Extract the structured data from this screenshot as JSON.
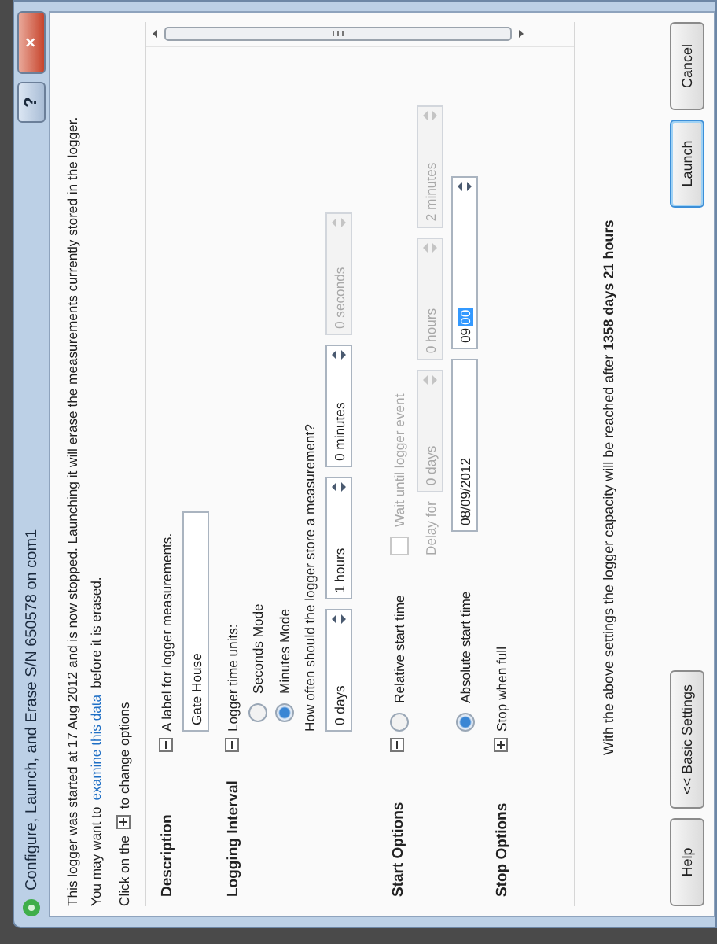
{
  "window": {
    "title": "Configure, Launch, and Erase S/N 650578 on com1",
    "help_button": "?",
    "close_button": "×"
  },
  "notice": "This logger was started at 17 Aug 2012 and is now stopped. Launching it will erase the measurements currently stored in the logger.",
  "examine": {
    "before": "You may want to",
    "link": "examine this data",
    "after": "before it is erased."
  },
  "hint": {
    "before": "Click on the",
    "after": "to change options"
  },
  "sections": [
    {
      "kind": "description",
      "label": "Description",
      "expanded": true,
      "prompt": "A label for logger measurements.",
      "value": "Gate House"
    },
    {
      "kind": "interval",
      "label": "Logging Interval",
      "expanded": true,
      "prompt": "Logger time units:",
      "modes": [
        {
          "label": "Seconds Mode",
          "selected": false
        },
        {
          "label": "Minutes Mode",
          "selected": true
        }
      ],
      "question": "How often should the logger store a measurement?",
      "fields": [
        {
          "value": "0 days",
          "disabled": false
        },
        {
          "value": "1 hours",
          "disabled": false
        },
        {
          "value": "0 minutes",
          "disabled": false
        },
        {
          "value": "0 seconds",
          "disabled": true
        }
      ]
    },
    {
      "kind": "start",
      "label": "Start Options",
      "expanded": true,
      "relative": {
        "label": "Relative start time",
        "selected": false,
        "wait": {
          "label": "Wait until logger event",
          "checked": false,
          "disabled": true
        },
        "delay_label": "Delay for",
        "fields": [
          {
            "value": "0 days",
            "disabled": true
          },
          {
            "value": "0 hours",
            "disabled": true
          },
          {
            "value": "2 minutes",
            "disabled": true
          }
        ]
      },
      "absolute": {
        "label": "Absolute start time",
        "selected": true,
        "date": "08/09/2012",
        "hour": "09",
        "minute": "00"
      }
    },
    {
      "kind": "stop",
      "label": "Stop Options",
      "expanded": false,
      "summary": "Stop when full"
    }
  ],
  "capacity": "With the above settings the logger capacity will be reached after **1358 days 21 hours**",
  "buttons_left": [
    {
      "label": "Help",
      "default": false
    },
    {
      "label": "<< Basic Settings",
      "default": false
    }
  ],
  "buttons_right": [
    {
      "label": "Launch",
      "default": true
    },
    {
      "label": "Cancel",
      "default": false
    }
  ]
}
